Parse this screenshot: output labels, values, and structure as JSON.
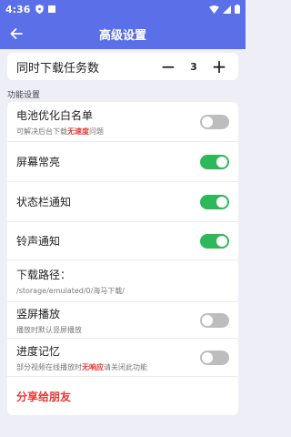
{
  "status": {
    "time": "4:36"
  },
  "appbar": {
    "title": "高级设置"
  },
  "tasks": {
    "label": "同时下载任务数",
    "value": "3",
    "minus": "−",
    "plus": "+"
  },
  "section": {
    "title": "功能设置"
  },
  "settings": {
    "battery": {
      "label": "电池优化白名单",
      "desc_before": "可解决后台下载",
      "desc_highlight": "无速度",
      "desc_after": "问题",
      "enabled": false
    },
    "screen_on": {
      "label": "屏幕常亮",
      "enabled": true
    },
    "statusbar_notify": {
      "label": "状态栏通知",
      "enabled": true
    },
    "ringtone_notify": {
      "label": "铃声通知",
      "enabled": true
    },
    "download_path": {
      "label": "下载路径：",
      "value": "/storage/emulated/0/海马下载/"
    },
    "portrait_play": {
      "label": "竖屏播放",
      "desc": "播放时默认竖屏播放",
      "enabled": false
    },
    "progress_memory": {
      "label": "进度记忆",
      "desc_before": "部分视频在线播放时",
      "desc_highlight": "无响应",
      "desc_after": "请关闭此功能",
      "enabled": false
    },
    "share": {
      "label": "分享给朋友"
    }
  },
  "colors": {
    "primary": "#5a6fe8",
    "toggle_on": "#2db85a",
    "toggle_off": "#bdbdbd",
    "highlight": "#e53935"
  }
}
